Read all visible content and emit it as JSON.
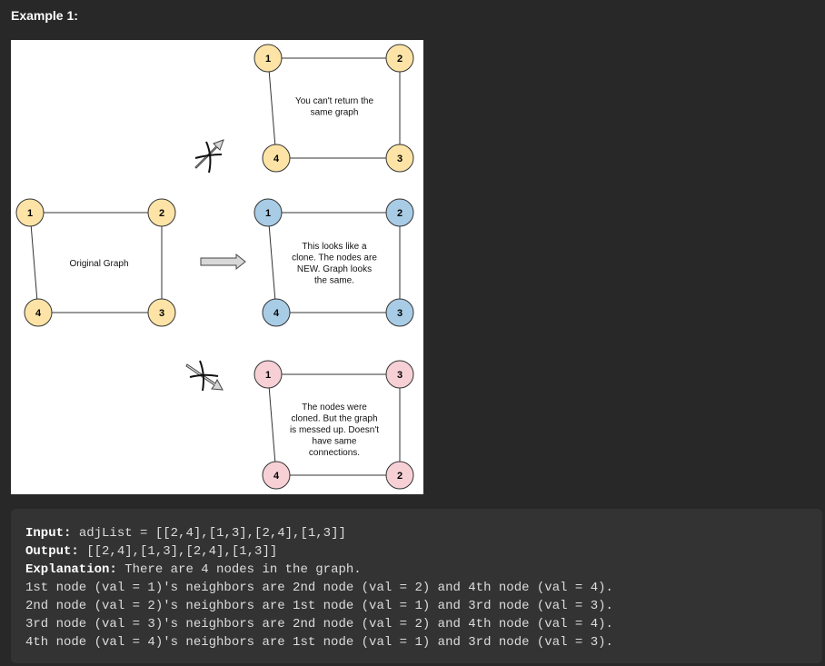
{
  "heading": "Example 1:",
  "figure": {
    "original_label": "Original Graph",
    "graphs": [
      {
        "id": "top",
        "fill": "#fde4a6",
        "labels": {
          "tl": "1",
          "tr": "2",
          "br": "3",
          "bl": "4"
        },
        "note": [
          "You can't return the",
          "same graph"
        ]
      },
      {
        "id": "original",
        "fill": "#fde4a6",
        "labels": {
          "tl": "1",
          "tr": "2",
          "br": "3",
          "bl": "4"
        },
        "note": [
          "Original Graph"
        ]
      },
      {
        "id": "middle",
        "fill": "#a8cce6",
        "labels": {
          "tl": "1",
          "tr": "2",
          "br": "3",
          "bl": "4"
        },
        "note": [
          "This looks like a",
          "clone. The nodes are",
          "NEW. Graph looks",
          "the same."
        ]
      },
      {
        "id": "bottom",
        "fill": "#f7d0d6",
        "labels": {
          "tl": "1",
          "tr": "3",
          "br": "2",
          "bl": "4"
        },
        "note": [
          "The nodes were",
          "cloned. But the graph",
          "is messed up. Doesn't",
          "have same",
          "connections."
        ]
      }
    ]
  },
  "explanation": {
    "input_label": "Input:",
    "input_value": " adjList = [[2,4],[1,3],[2,4],[1,3]]",
    "output_label": "Output:",
    "output_value": " [[2,4],[1,3],[2,4],[1,3]]",
    "explanation_label": "Explanation:",
    "explanation_value": " There are 4 nodes in the graph.",
    "lines": [
      "1st node (val = 1)'s neighbors are 2nd node (val = 2) and 4th node (val = 4).",
      "2nd node (val = 2)'s neighbors are 1st node (val = 1) and 3rd node (val = 3).",
      "3rd node (val = 3)'s neighbors are 2nd node (val = 2) and 4th node (val = 4).",
      "4th node (val = 4)'s neighbors are 1st node (val = 1) and 3rd node (val = 3)."
    ]
  }
}
